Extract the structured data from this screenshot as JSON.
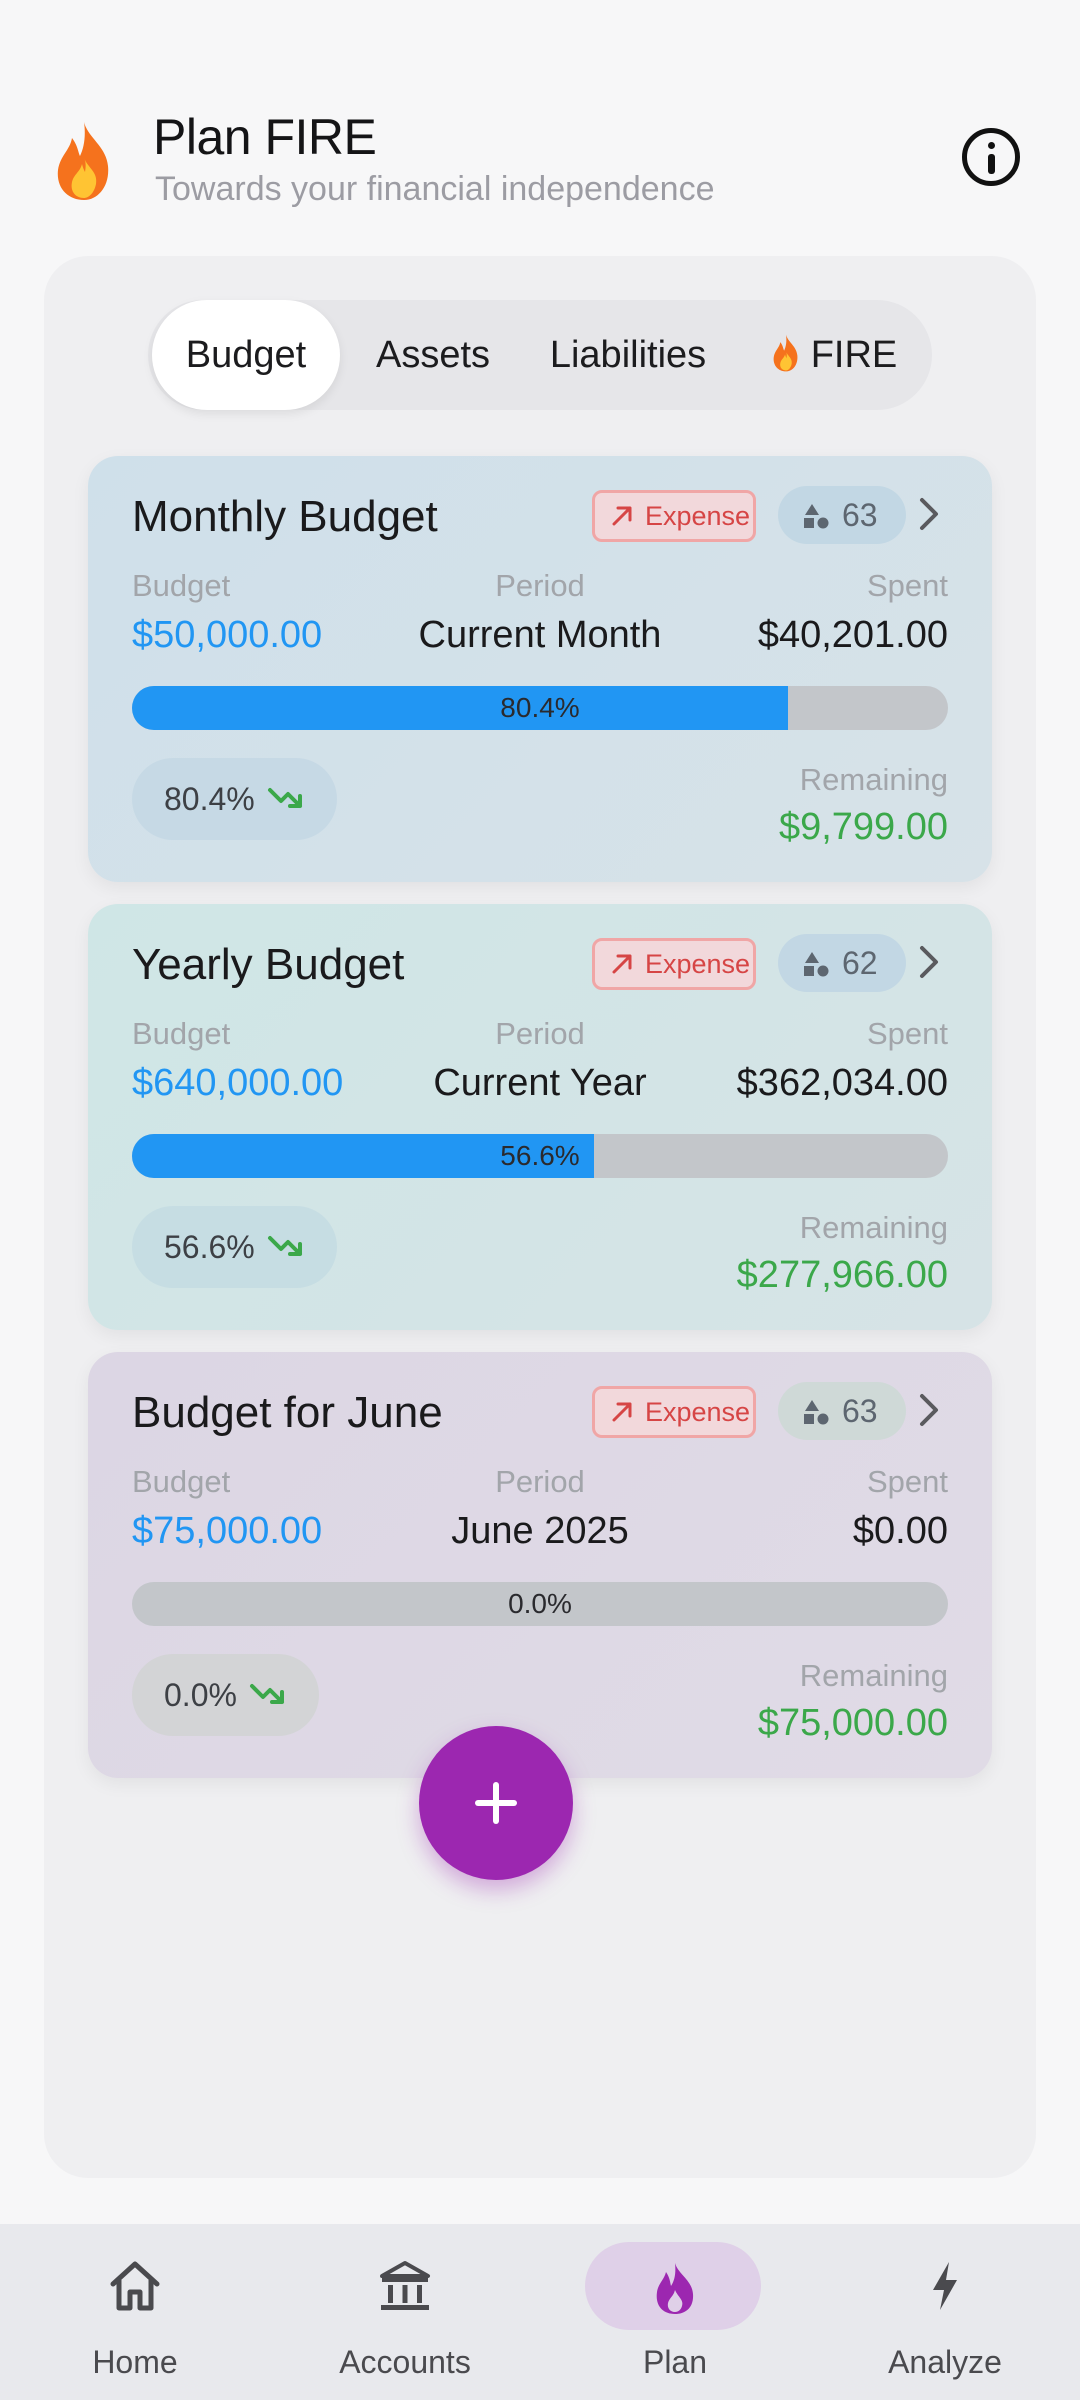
{
  "header": {
    "title": "Plan FIRE",
    "subtitle": "Towards your financial independence",
    "logo_icon": "flame-icon",
    "info_icon": "info-icon"
  },
  "tabs": [
    {
      "label": "Budget",
      "active": true
    },
    {
      "label": "Assets",
      "active": false
    },
    {
      "label": "Liabilities",
      "active": false
    },
    {
      "label": "FIRE",
      "active": false,
      "icon": "flame-icon"
    }
  ],
  "labels": {
    "budget": "Budget",
    "period": "Period",
    "spent": "Spent",
    "remaining": "Remaining"
  },
  "cards": [
    {
      "title": "Monthly Budget",
      "type_chip": "Expense",
      "count": "63",
      "budget": "$50,000.00",
      "period": "Current Month",
      "spent": "$40,201.00",
      "progress": 0.804,
      "progress_label": "80.4%",
      "percent": "80.4%",
      "remaining": "$9,799.00"
    },
    {
      "title": "Yearly Budget",
      "type_chip": "Expense",
      "count": "62",
      "budget": "$640,000.00",
      "period": "Current Year",
      "spent": "$362,034.00",
      "progress": 0.566,
      "progress_label": "56.6%",
      "percent": "56.6%",
      "remaining": "$277,966.00"
    },
    {
      "title": "Budget for June",
      "type_chip": "Expense",
      "count": "63",
      "budget": "$75,000.00",
      "period": "June 2025",
      "spent": "$0.00",
      "progress": 0.0,
      "progress_label": "0.0%",
      "percent": "0.0%",
      "remaining": "$75,000.00"
    }
  ],
  "fab": {
    "icon": "plus-icon"
  },
  "nav": [
    {
      "label": "Home",
      "icon": "home-icon"
    },
    {
      "label": "Accounts",
      "icon": "bank-icon"
    },
    {
      "label": "Plan",
      "icon": "flame-icon",
      "active": true
    },
    {
      "label": "Analyze",
      "icon": "lightning-icon"
    }
  ],
  "colors": {
    "accent": "#9c27b0",
    "progress": "#2196f3",
    "remaining": "#3ba84a",
    "expense": "#d64545"
  }
}
